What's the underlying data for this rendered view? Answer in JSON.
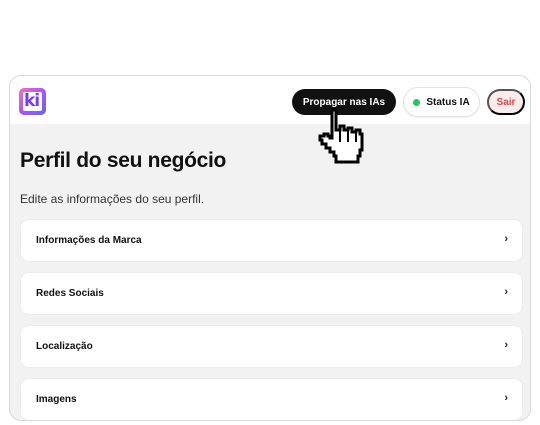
{
  "header": {
    "logo_text": "ki",
    "propagate_label": "Propagar nas IAs",
    "status_label": "Status IA",
    "exit_label": "Sair",
    "status_color": "#22c55e"
  },
  "main": {
    "title": "Perfil do seu negócio",
    "subtitle": "Edite as informações do seu perfil.",
    "sections": [
      {
        "label": "Informações da Marca",
        "chevron": "›"
      },
      {
        "label": "Redes Sociais",
        "chevron": "›"
      },
      {
        "label": "Localização",
        "chevron": "›"
      },
      {
        "label": "Imagens",
        "chevron": "›"
      }
    ]
  },
  "cursor": {
    "icon": "hand-pointer-icon"
  }
}
